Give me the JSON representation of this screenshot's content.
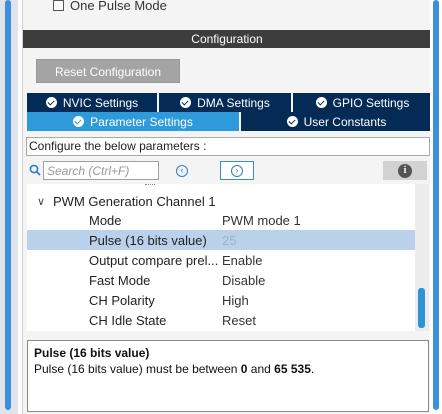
{
  "top": {
    "one_pulse_mode_label": "One Pulse Mode"
  },
  "configuration": {
    "header": "Configuration",
    "reset_button": "Reset Configuration"
  },
  "tabs": {
    "row1": [
      {
        "label": "NVIC Settings"
      },
      {
        "label": "DMA Settings"
      },
      {
        "label": "GPIO Settings"
      }
    ],
    "row2": [
      {
        "label": "Parameter Settings",
        "active": true
      },
      {
        "label": "User Constants"
      }
    ]
  },
  "params": {
    "configure_label": "Configure the below parameters :",
    "search_placeholder": "Search (Ctrl+F)",
    "group_label": "PWM Generation Channel 1",
    "rows": [
      {
        "name": "Mode",
        "value": "PWM mode 1"
      },
      {
        "name": "Pulse (16 bits value)",
        "value": "25",
        "selected": true
      },
      {
        "name": "Output compare prel...",
        "value": "Enable"
      },
      {
        "name": "Fast Mode",
        "value": "Disable"
      },
      {
        "name": "CH Polarity",
        "value": "High"
      },
      {
        "name": "CH Idle State",
        "value": "Reset"
      }
    ]
  },
  "description": {
    "title": "Pulse (16 bits value)",
    "text_before": "Pulse (16 bits value) must be between ",
    "min": "0",
    "text_and": " and ",
    "max": "65 535",
    "text_end": "."
  },
  "colors": {
    "tab_dark": "#042b56",
    "tab_active": "#2f9ad9",
    "header_bg": "#3d3d3d",
    "selected_row": "#b9d1ea"
  },
  "icons": [
    "check-circle-icon",
    "search-icon",
    "prev-circle-icon",
    "next-circle-icon",
    "info-icon",
    "chevron-down-icon"
  ]
}
